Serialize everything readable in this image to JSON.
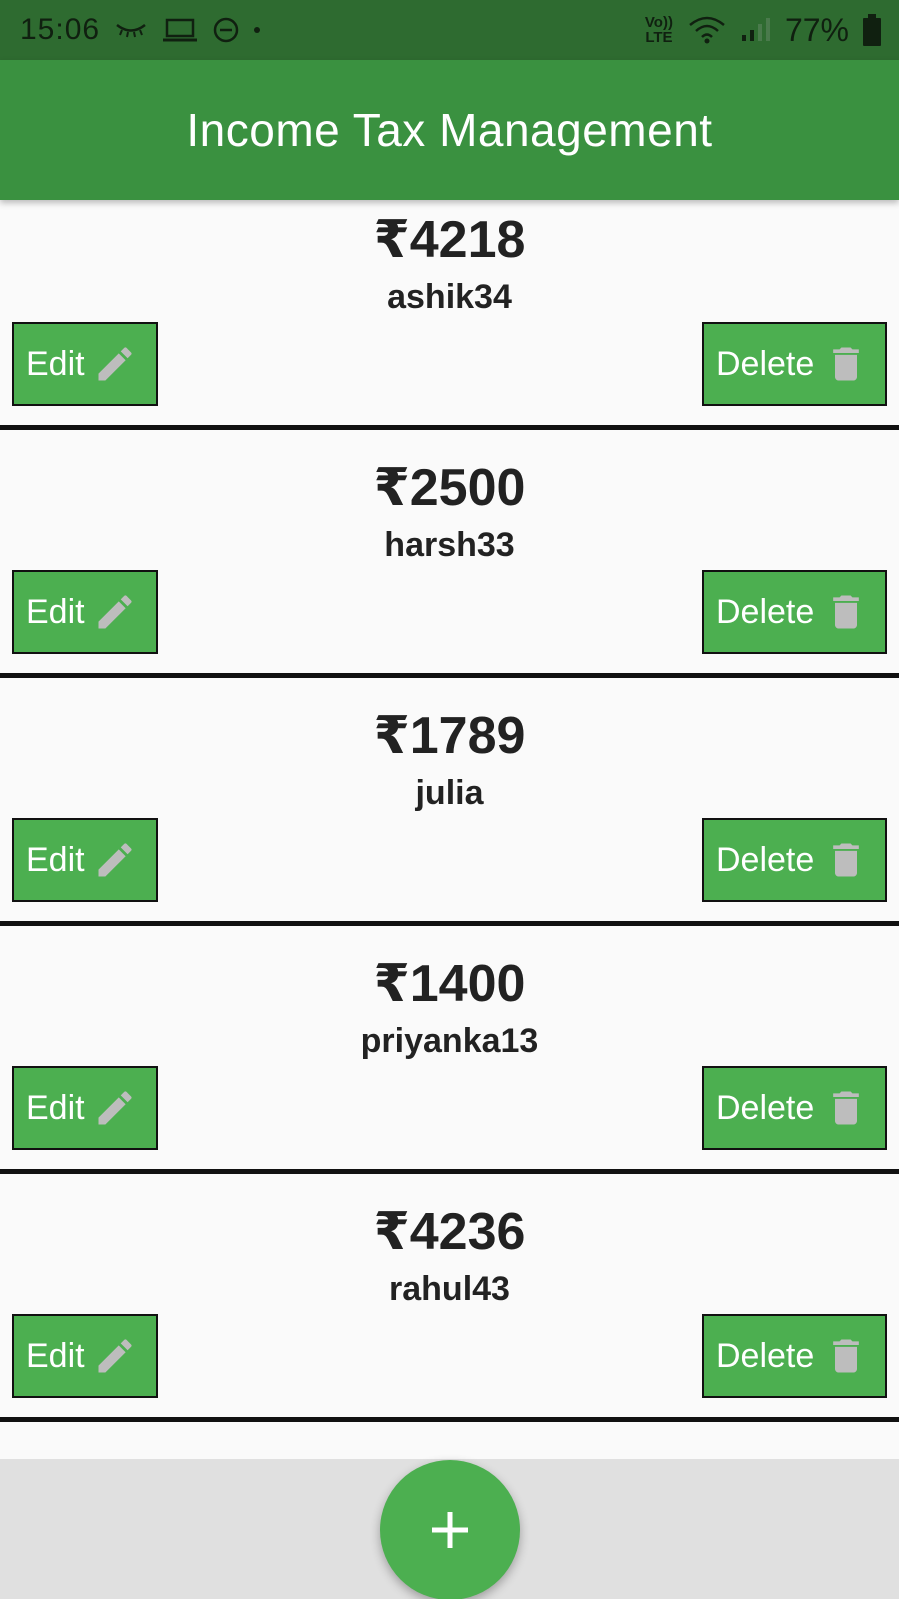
{
  "status_bar": {
    "time": "15:06",
    "volte_top": "Vo))",
    "volte_bottom": "LTE",
    "battery": "77%",
    "icons": [
      "eye-closed-icon",
      "laptop-icon",
      "dnd-icon",
      "dot-icon",
      "volte-icon",
      "wifi-icon",
      "signal-icon",
      "battery-icon"
    ]
  },
  "app_bar": {
    "title": "Income Tax Management"
  },
  "records": [
    {
      "amount": "₹4218",
      "name": "ashik34"
    },
    {
      "amount": "₹2500",
      "name": "harsh33"
    },
    {
      "amount": "₹1789",
      "name": "julia"
    },
    {
      "amount": "₹1400",
      "name": "priyanka13"
    },
    {
      "amount": "₹4236",
      "name": "rahul43"
    }
  ],
  "buttons": {
    "edit_label": "Edit",
    "delete_label": "Delete",
    "edit_icon": "pencil-icon",
    "delete_icon": "trash-icon"
  },
  "fab": {
    "icon": "plus-icon"
  },
  "colors": {
    "status_bar": "#2e6b30",
    "app_bar": "#3a9140",
    "button": "#4caf50",
    "icon_gray": "#bdbdbd",
    "bottom_bar": "#e0e0e0"
  }
}
